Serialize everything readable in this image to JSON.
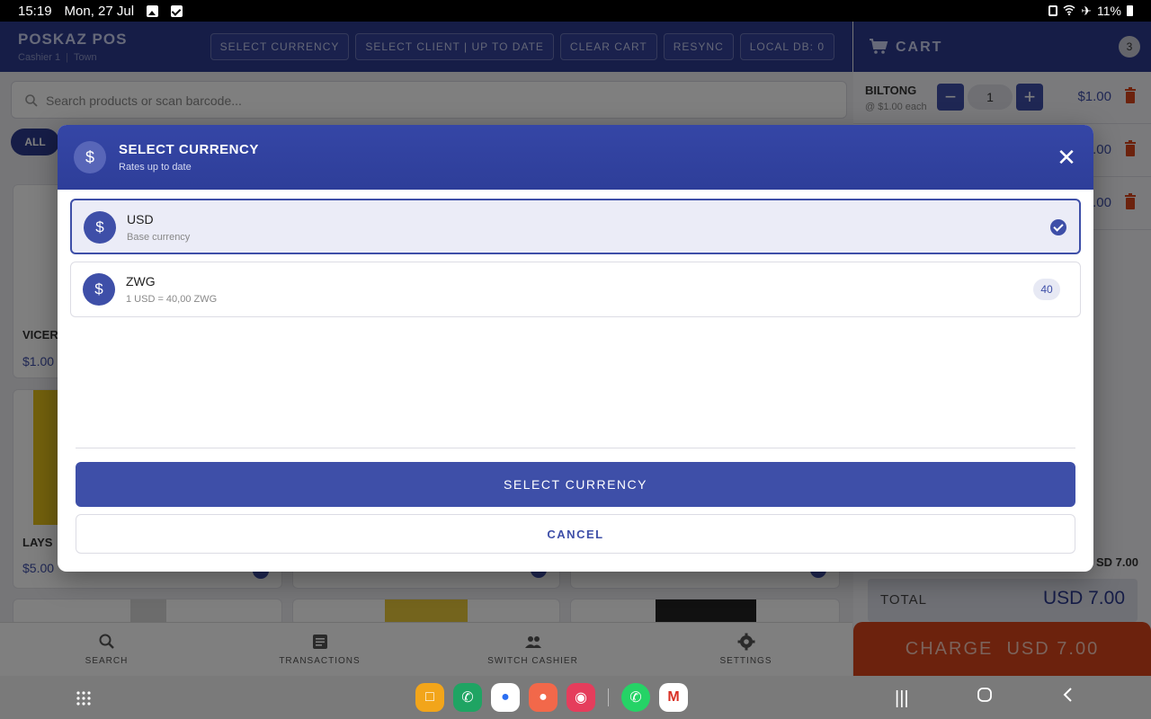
{
  "status_bar": {
    "time": "15:19",
    "date": "Mon, 27 Jul",
    "battery": "11%"
  },
  "header": {
    "title": "POSKAZ POS",
    "cashier": "Cashier 1",
    "location": "Town",
    "buttons": [
      "SELECT CURRENCY",
      "SELECT CLIENT | UP TO DATE",
      "CLEAR CART",
      "RESYNC",
      "LOCAL DB: 0"
    ]
  },
  "search": {
    "placeholder": "Search products or scan barcode..."
  },
  "filter": {
    "active": "ALL"
  },
  "products": [
    {
      "name": "VICER",
      "price": "$1.00"
    },
    {
      "name": "LAYS",
      "price": "$5.00"
    }
  ],
  "bottom_nav": [
    "SEARCH",
    "TRANSACTIONS",
    "SWITCH CASHIER",
    "SETTINGS"
  ],
  "cart": {
    "title": "CART",
    "count": "3",
    "items": [
      {
        "name": "BILTONG",
        "each": "@ $1.00 each",
        "qty": "1",
        "price": "$1.00"
      },
      {
        "price": ".00"
      },
      {
        "price": ".00"
      }
    ],
    "subtotal": "SD 7.00",
    "total_label": "TOTAL",
    "total_value": "USD 7.00",
    "charge_label": "CHARGE",
    "charge_amount": "USD 7.00"
  },
  "modal": {
    "title": "SELECT CURRENCY",
    "subtitle": "Rates up to date",
    "options": [
      {
        "code": "USD",
        "sub": "Base currency",
        "selected": true
      },
      {
        "code": "ZWG",
        "sub": "1 USD = 40,00 ZWG",
        "rate": "40",
        "selected": false
      }
    ],
    "primary_button": "SELECT CURRENCY",
    "cancel_button": "CANCEL"
  },
  "colors": {
    "primary": "#3e4fa8",
    "header": "#2c3a8f",
    "charge": "#d8441b"
  },
  "icons": [
    "search-icon",
    "cart-icon",
    "trash-icon",
    "dollar-icon",
    "close-icon",
    "check-icon",
    "transactions-icon",
    "switch-cashier-icon",
    "settings-icon"
  ]
}
